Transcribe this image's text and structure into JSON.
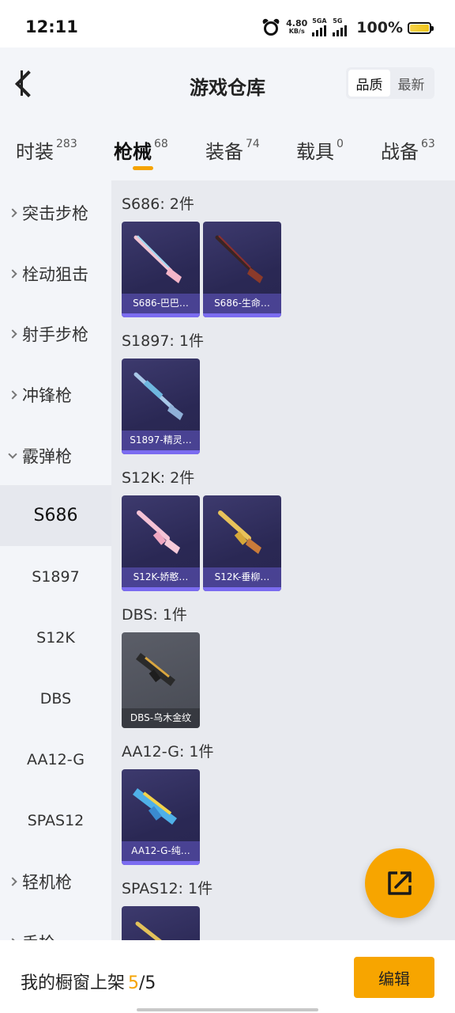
{
  "status_bar": {
    "time": "12:11",
    "net_speed_value": "4.80",
    "net_speed_unit": "KB/s",
    "sim1_tag": "5GA",
    "sim2_tag": "5G",
    "battery_percent": "100%"
  },
  "header": {
    "title": "游戏仓库",
    "sort_options": [
      "品质",
      "最新"
    ]
  },
  "tabs": [
    {
      "label": "时装",
      "count": "283"
    },
    {
      "label": "枪械",
      "count": "68"
    },
    {
      "label": "装备",
      "count": "74"
    },
    {
      "label": "载具",
      "count": "0"
    },
    {
      "label": "战备",
      "count": "63"
    }
  ],
  "sidebar": {
    "categories": [
      "突击步枪",
      "栓动狙击",
      "射手步枪",
      "冲锋枪",
      "霰弹枪",
      "轻机枪",
      "手枪"
    ],
    "subitems": [
      "S686",
      "S1897",
      "S12K",
      "DBS",
      "AA12-G",
      "SPAS12"
    ]
  },
  "groups": [
    {
      "title": "S686: 2件",
      "items": [
        "S686-巴巴…",
        "S686-生命…"
      ]
    },
    {
      "title": "S1897: 1件",
      "items": [
        "S1897-精灵…"
      ]
    },
    {
      "title": "S12K: 2件",
      "items": [
        "S12K-娇憨…",
        "S12K-垂柳…"
      ]
    },
    {
      "title": "DBS: 1件",
      "items": [
        "DBS-乌木金纹"
      ]
    },
    {
      "title": "AA12-G: 1件",
      "items": [
        "AA12-G-纯…"
      ]
    },
    {
      "title": "SPAS12: 1件",
      "items": [
        ""
      ]
    }
  ],
  "bottom": {
    "showcase_label": "我的橱窗上架",
    "showcase_current": "5",
    "showcase_total": "/5",
    "edit_label": "编辑"
  },
  "colors": {
    "accent": "#f7a500",
    "card_purple": "#2a2854",
    "card_grey": "#474a53"
  }
}
